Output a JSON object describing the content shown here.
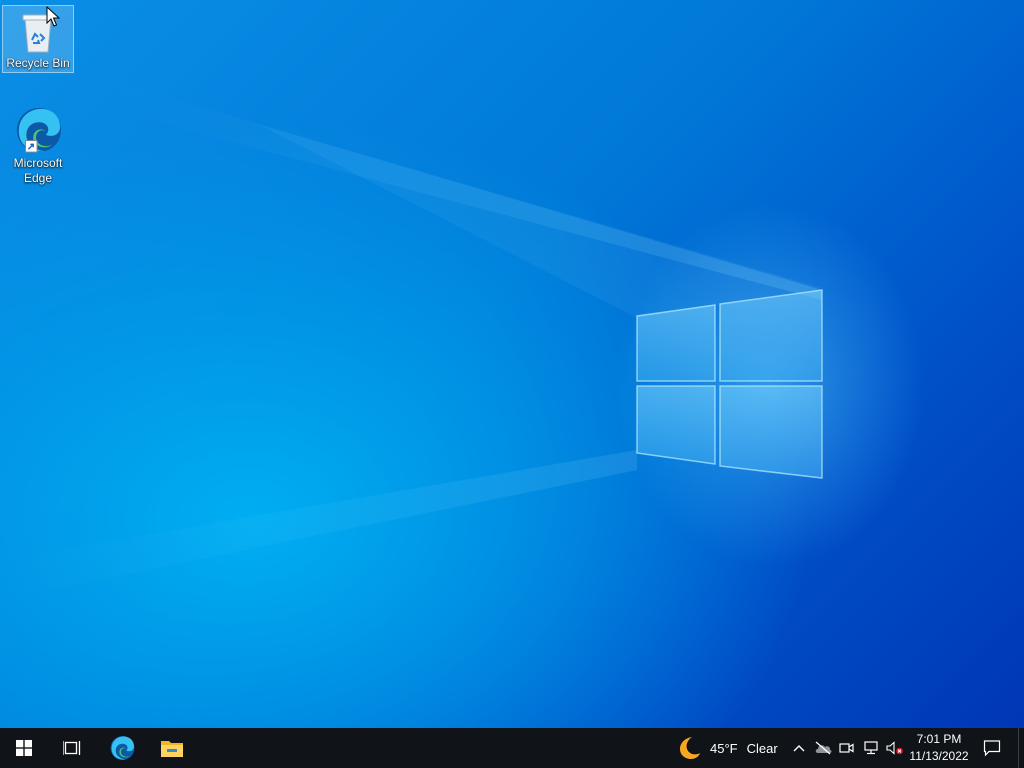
{
  "desktop": {
    "icons": [
      {
        "label": "Recycle Bin",
        "icon": "recycle-bin-icon"
      },
      {
        "label": "Microsoft\nEdge",
        "icon": "edge-icon"
      }
    ]
  },
  "taskbar": {
    "start": {
      "icon": "windows-start-icon"
    },
    "task_view": {
      "icon": "task-view-icon"
    },
    "pinned": [
      {
        "icon": "edge-icon"
      },
      {
        "icon": "file-explorer-icon"
      }
    ],
    "weather": {
      "temperature": "45°F",
      "condition": "Clear",
      "icon": "moon-icon"
    },
    "tray_icons": [
      "chevron-up-icon",
      "onedrive-icon",
      "meet-now-icon",
      "network-icon",
      "volume-muted-icon"
    ],
    "clock": {
      "time": "7:01 PM",
      "date": "11/13/2022"
    },
    "notifications": {
      "icon": "action-center-icon"
    }
  },
  "colors": {
    "taskbar_bg": "#101317",
    "desktop_blue": "#0078d7",
    "accent_light": "#00aef2"
  }
}
